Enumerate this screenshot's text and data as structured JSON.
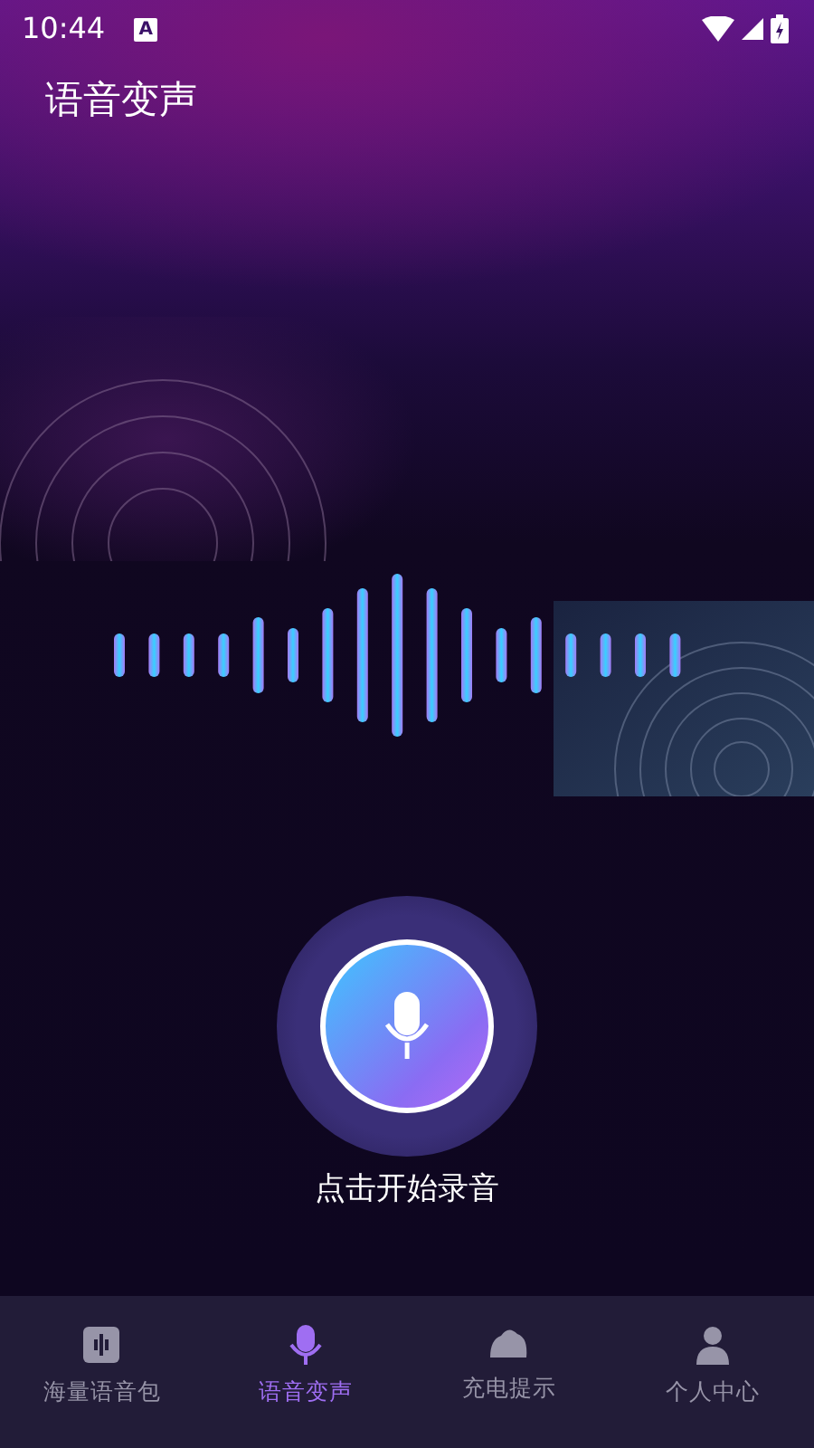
{
  "status_bar": {
    "time": "10:44",
    "notification": "A"
  },
  "title": "语音变声",
  "record": {
    "label": "点击开始录音"
  },
  "tabs": [
    {
      "label": "海量语音包",
      "selected": false
    },
    {
      "label": "语音变声",
      "selected": true
    },
    {
      "label": "充电提示",
      "selected": false
    },
    {
      "label": "个人中心",
      "selected": false
    }
  ]
}
